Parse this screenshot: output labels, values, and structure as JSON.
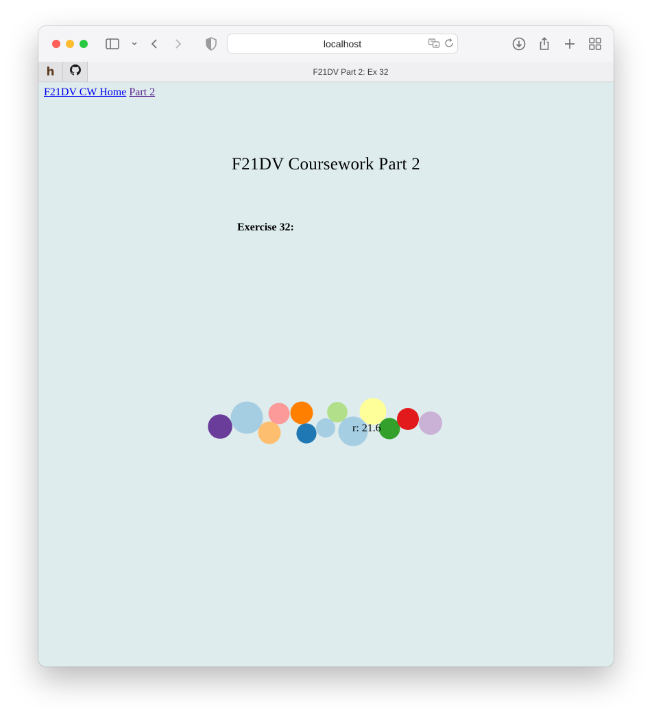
{
  "browser": {
    "address": "localhost",
    "tab_title": "F21DV Part 2: Ex 32",
    "icons": {
      "sidebar": "sidebar-icon",
      "chevron": "chevron-down-icon",
      "back": "back-icon",
      "forward": "forward-icon",
      "shield": "shield-icon",
      "translate": "translate-icon",
      "reload": "reload-icon",
      "download": "download-icon",
      "share": "share-icon",
      "new_tab": "plus-icon",
      "tabs": "tab-overview-icon"
    },
    "pinned_tabs": [
      {
        "label": "h",
        "icon": "h-icon"
      },
      {
        "label": "",
        "icon": "github-icon"
      }
    ]
  },
  "page": {
    "nav": [
      {
        "label": "F21DV CW Home",
        "visited": false
      },
      {
        "label": "Part 2",
        "visited": true
      }
    ],
    "title": "F21DV Coursework Part 2",
    "exercise_heading": "Exercise 32:",
    "tooltip": "r: 21.6",
    "colors": {
      "background": "#deeced",
      "link": "#0000ee",
      "visited_link": "#551a8b"
    }
  },
  "chart_data": {
    "type": "scatter",
    "encoding": "bubble",
    "points": [
      {
        "r": 17.8,
        "color": "#6a3d9a"
      },
      {
        "r": 23.5,
        "color": "#a6cee3"
      },
      {
        "r": 16.5,
        "color": "#fdbf6f"
      },
      {
        "r": 15.5,
        "color": "#fb9a99"
      },
      {
        "r": 16.5,
        "color": "#ff7f00"
      },
      {
        "r": 14.6,
        "color": "#1f78b4"
      },
      {
        "r": 14.0,
        "color": "#a6cee3"
      },
      {
        "r": 14.9,
        "color": "#b2df8a"
      },
      {
        "r": 21.6,
        "color": "#a6cee3"
      },
      {
        "r": 19.5,
        "color": "#ffff99"
      },
      {
        "r": 15.5,
        "color": "#33a02c"
      },
      {
        "r": 16.0,
        "color": "#e31a1c"
      },
      {
        "r": 17.0,
        "color": "#cab2d6"
      }
    ]
  }
}
